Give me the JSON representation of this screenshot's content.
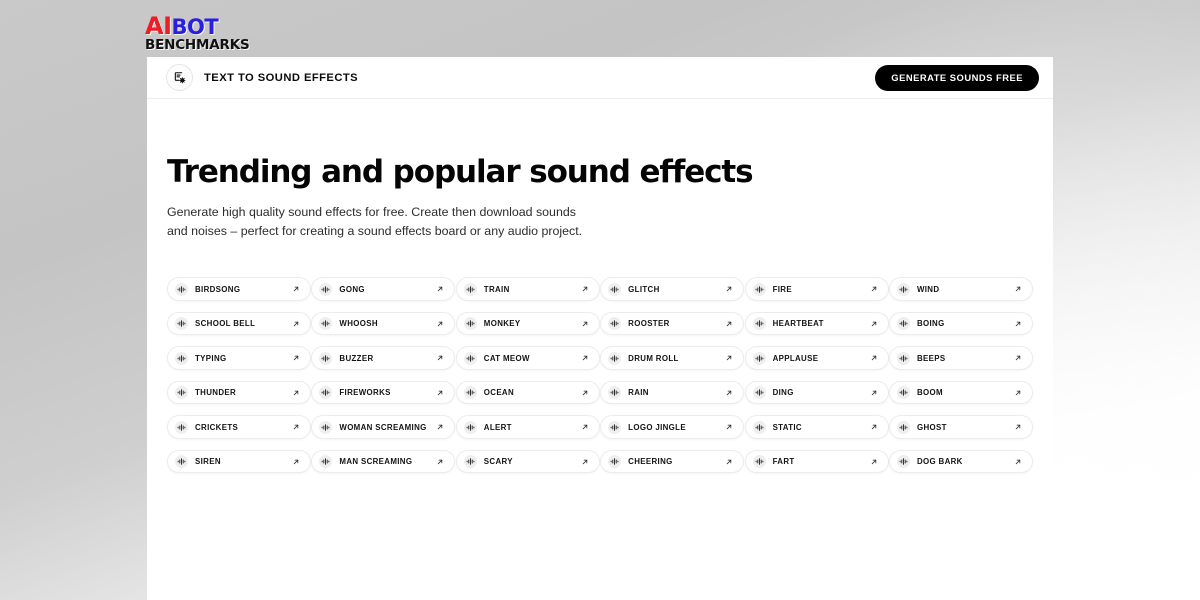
{
  "logo": {
    "part1": "AI",
    "part2": "BOT",
    "part3": "BENCHMARKS",
    "color_ai": "#ee1c25",
    "color_bot": "#2a1fe0",
    "color_benchmarks": "#111111"
  },
  "header": {
    "icon": "text-to-sound-settings-icon",
    "title": "TEXT TO SOUND EFFECTS",
    "cta_label": "GENERATE SOUNDS FREE",
    "cta_bg": "#000000",
    "cta_fg": "#ffffff"
  },
  "main": {
    "title": "Trending and popular sound effects",
    "subtitle": "Generate high quality sound effects for free. Create then download sounds and noises – perfect for creating a sound effects board or any audio project.",
    "arrow_glyph": "↗",
    "pill_icon": "audio-waveform-icon",
    "pills": [
      "BIRDSONG",
      "GONG",
      "TRAIN",
      "GLITCH",
      "FIRE",
      "WIND",
      "SCHOOL BELL",
      "WHOOSH",
      "MONKEY",
      "ROOSTER",
      "HEARTBEAT",
      "BOING",
      "TYPING",
      "BUZZER",
      "CAT MEOW",
      "DRUM ROLL",
      "APPLAUSE",
      "BEEPS",
      "THUNDER",
      "FIREWORKS",
      "OCEAN",
      "RAIN",
      "DING",
      "BOOM",
      "CRICKETS",
      "WOMAN SCREAMING",
      "ALERT",
      "LOGO JINGLE",
      "STATIC",
      "GHOST",
      "SIREN",
      "MAN SCREAMING",
      "SCARY",
      "CHEERING",
      "FART",
      "DOG BARK"
    ]
  }
}
